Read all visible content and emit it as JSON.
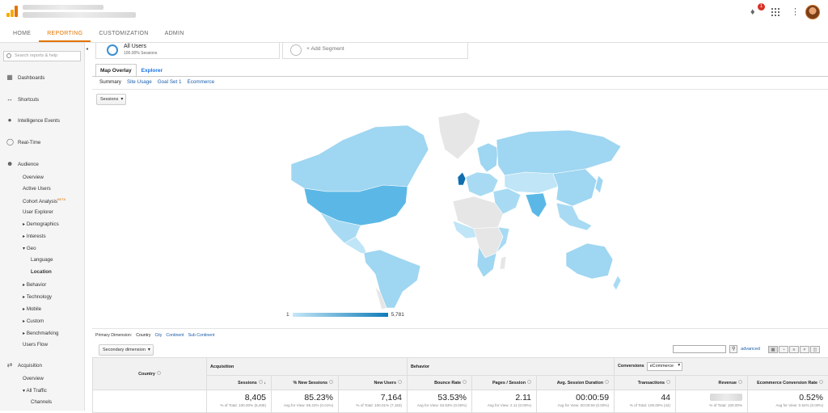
{
  "header": {
    "account_name": "",
    "property_name": "",
    "notification_count": "1"
  },
  "tabs": [
    {
      "label": "HOME"
    },
    {
      "label": "REPORTING"
    },
    {
      "label": "CUSTOMIZATION"
    },
    {
      "label": "ADMIN"
    }
  ],
  "sidebar": {
    "search_placeholder": "Search reports & help",
    "top": [
      {
        "label": "Dashboards",
        "icon": "dashboards-icon"
      },
      {
        "label": "Shortcuts",
        "icon": "shortcuts-icon"
      },
      {
        "label": "Intelligence Events",
        "icon": "intelligence-icon"
      },
      {
        "label": "Real-Time",
        "icon": "realtime-icon"
      },
      {
        "label": "Audience",
        "icon": "audience-icon"
      },
      {
        "label": "Acquisition",
        "icon": "acquisition-icon"
      }
    ],
    "audience_items": [
      {
        "label": "Overview"
      },
      {
        "label": "Active Users"
      },
      {
        "label": "Cohort Analysis"
      },
      {
        "label": "User Explorer"
      },
      {
        "label": "Demographics"
      },
      {
        "label": "Interests"
      },
      {
        "label": "Geo"
      },
      {
        "label": "Language"
      },
      {
        "label": "Location"
      },
      {
        "label": "Behavior"
      },
      {
        "label": "Technology"
      },
      {
        "label": "Mobile"
      },
      {
        "label": "Custom"
      },
      {
        "label": "Benchmarking"
      },
      {
        "label": "Users Flow"
      }
    ],
    "beta": "BETA",
    "acquisition_items": [
      {
        "label": "Overview"
      },
      {
        "label": "All Traffic"
      },
      {
        "label": "Channels"
      }
    ]
  },
  "segments": {
    "all_users": "All Users",
    "all_users_pct": "100.00% Sessions",
    "add_segment": "+ Add Segment"
  },
  "view_tabs": [
    "Map Overlay",
    "Explorer"
  ],
  "sub_tabs": [
    "Summary",
    "Site Usage",
    "Goal Set 1",
    "Ecommerce"
  ],
  "metric_dropdown": "Sessions",
  "legend": {
    "min": "1",
    "max": "5,781"
  },
  "primary_dimension": {
    "label": "Primary Dimension:",
    "options": [
      "Country",
      "City",
      "Continent",
      "Sub Continent"
    ]
  },
  "secondary_dimension": "Secondary dimension",
  "advanced": "advanced",
  "table": {
    "country_header": "Country",
    "groups": [
      "Acquisition",
      "Behavior",
      "Conversions"
    ],
    "conversion_select": "eCommerce",
    "columns": [
      "Sessions",
      "% New Sessions",
      "New Users",
      "Bounce Rate",
      "Pages / Session",
      "Avg. Session Duration",
      "Transactions",
      "Revenue",
      "Ecommerce Conversion Rate"
    ],
    "totals": [
      {
        "value": "8,405",
        "sub": "% of Total: 100.00% (8,405)"
      },
      {
        "value": "85.23%",
        "sub": "Avg for View: 85.22% (0.01%)"
      },
      {
        "value": "7,164",
        "sub": "% of Total: 100.01% (7,163)"
      },
      {
        "value": "53.53%",
        "sub": "Avg for View: 53.53% (0.00%)"
      },
      {
        "value": "2.11",
        "sub": "Avg for View: 2.11 (0.00%)"
      },
      {
        "value": "00:00:59",
        "sub": "Avg for View: 00:00:59 (0.00%)"
      },
      {
        "value": "44",
        "sub": "% of Total: 100.00% (44)"
      },
      {
        "value": "",
        "sub": "% of Total: 100.00%"
      },
      {
        "value": "0.52%",
        "sub": "Avg for View: 0.52% (0.00%)"
      }
    ]
  },
  "colors": {
    "accent": "#e37400",
    "map_low": "#c6e7f7",
    "map_high": "#0f7bb8",
    "map_none": "#e6e6e6"
  }
}
